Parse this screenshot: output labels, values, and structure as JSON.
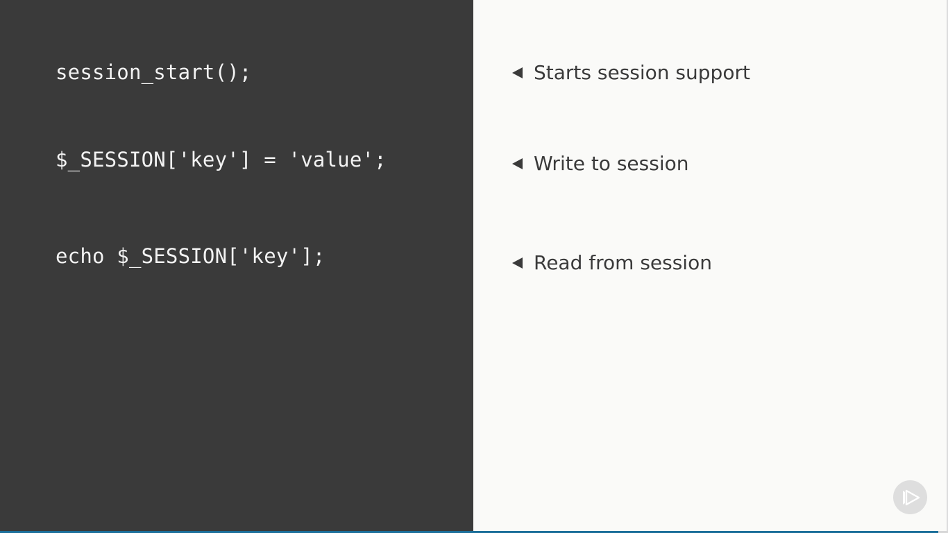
{
  "code": {
    "lines": [
      "session_start();",
      "$_SESSION['key'] = 'value';",
      "echo $_SESSION['key'];"
    ]
  },
  "notes": {
    "items": [
      "Starts session support",
      "Write to session",
      "Read from session"
    ]
  },
  "player": {
    "progress": 0.99,
    "icon": "play-logo-icon"
  },
  "colors": {
    "code_bg": "#3a3a3a",
    "notes_bg": "#fafaf8",
    "code_text": "#f2f2f2",
    "progress_fill": "#1c6f9a"
  }
}
